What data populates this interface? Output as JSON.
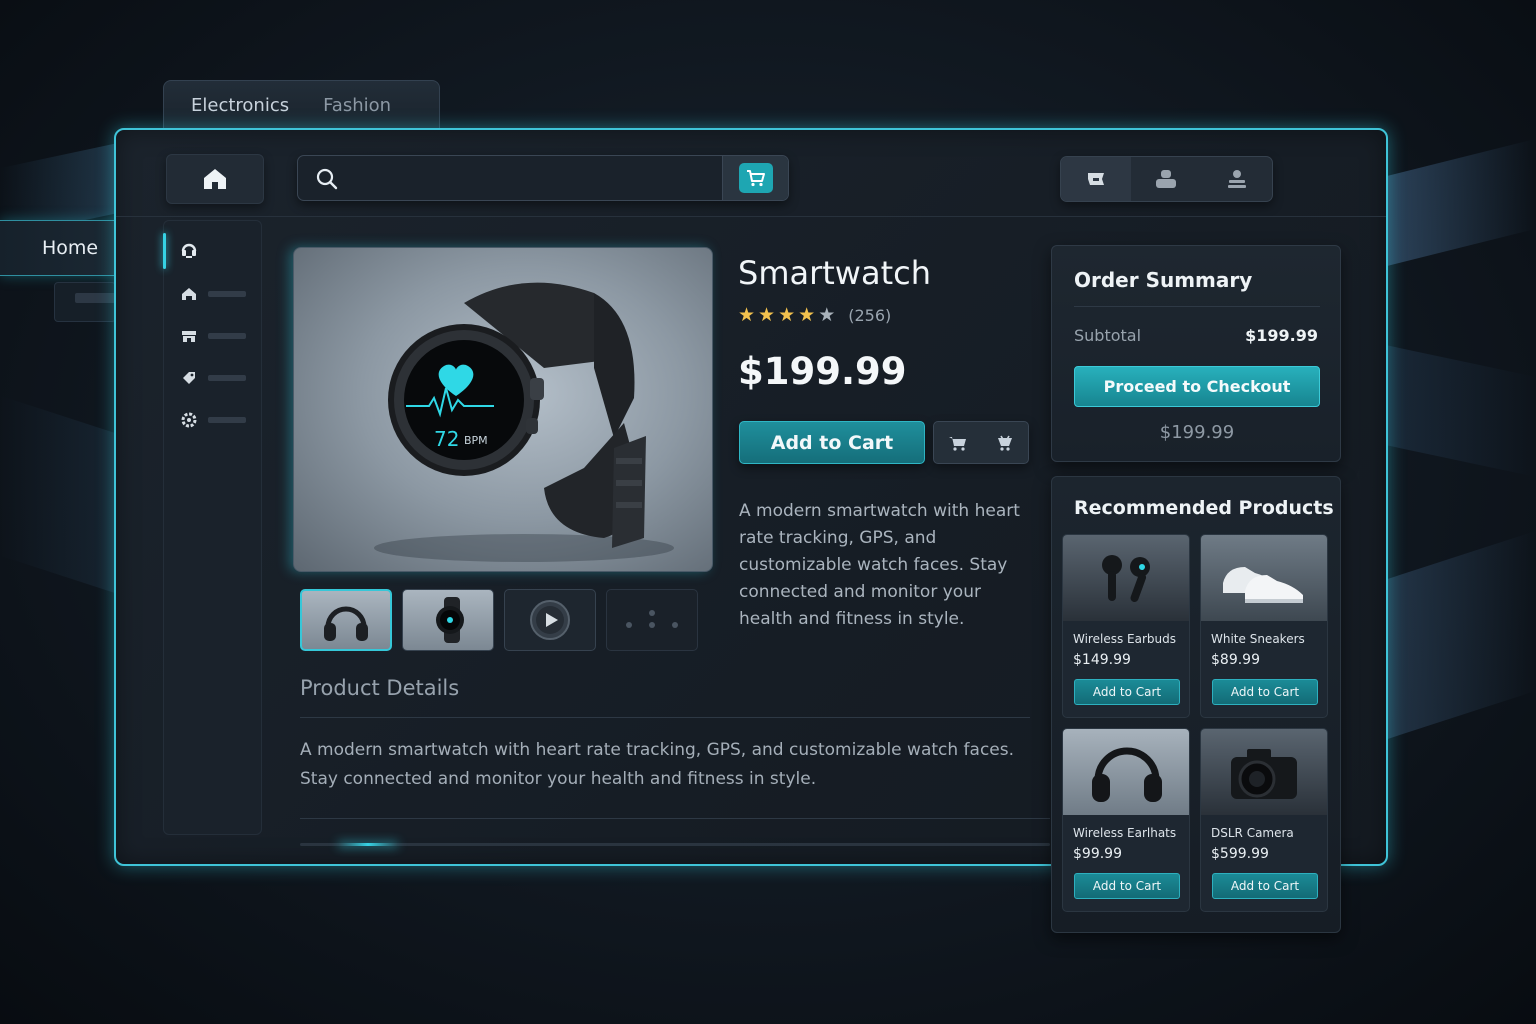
{
  "top_tabs": [
    {
      "label": "Electronics",
      "active": true
    },
    {
      "label": "Fashion",
      "active": false
    }
  ],
  "home_tab": {
    "label": "Home"
  },
  "search": {
    "value": "",
    "placeholder": ""
  },
  "header_icons": [
    "shop-icon",
    "user-icon",
    "account-icon"
  ],
  "sidebar": {
    "items": [
      {
        "icon": "headset-icon",
        "active": true
      },
      {
        "icon": "home-icon",
        "active": false
      },
      {
        "icon": "store-icon",
        "active": false
      },
      {
        "icon": "tag-icon",
        "active": false
      },
      {
        "icon": "gear-icon",
        "active": false
      }
    ]
  },
  "product": {
    "title": "Smartwatch",
    "rating": 4.5,
    "review_count": "(256)",
    "price": "$199.99",
    "add_to_cart": "Add to Cart",
    "description": "A modern smartwatch with heart rate tracking, GPS, and customizable watch faces. Stay connected and monitor your health and fitness in style.",
    "screen_bpm": "72",
    "screen_unit": "BPM"
  },
  "thumbnails": [
    "headphones",
    "smartwatch",
    "video",
    "more"
  ],
  "details": {
    "heading": "Product Details",
    "text": "A modern smartwatch with heart rate tracking, GPS, and customizable watch faces. Stay connected and monitor your health and fitness in style."
  },
  "image_carousel_progress": 0.08,
  "order_summary": {
    "title": "Order Summary",
    "subtotal_label": "Subtotal",
    "subtotal_value": "$199.99",
    "checkout_label": "Proceed to Checkout",
    "total": "$199.99"
  },
  "recommended": {
    "title": "Recommended Products",
    "items": [
      {
        "name": "Wireless Earbuds",
        "price": "$149.99",
        "button": "Add to Cart"
      },
      {
        "name": "White Sneakers",
        "price": "$89.99",
        "button": "Add to Cart"
      },
      {
        "name": "Wireless Earlhats",
        "price": "$99.99",
        "button": "Add to Cart"
      },
      {
        "name": "DSLR Camera",
        "price": "$599.99",
        "button": "Add to Cart"
      }
    ]
  },
  "colors": {
    "accent": "#36d2e4",
    "button": "#1f8f9c",
    "star": "#f2c14e",
    "background": "#121a23"
  }
}
